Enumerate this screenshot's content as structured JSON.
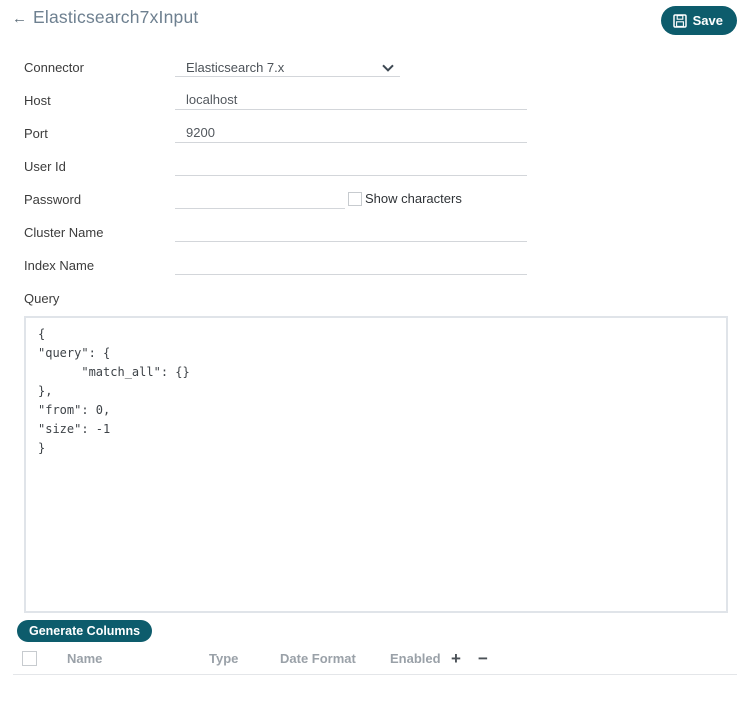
{
  "header": {
    "back_icon": "←",
    "title": "Elasticsearch7xInput",
    "save_button": {
      "label": "Save"
    }
  },
  "form": {
    "connector": {
      "label": "Connector",
      "value": "Elasticsearch 7.x"
    },
    "host": {
      "label": "Host",
      "value": "localhost"
    },
    "port": {
      "label": "Port",
      "value": "9200"
    },
    "user_id": {
      "label": "User Id",
      "value": ""
    },
    "password": {
      "label": "Password",
      "value": "",
      "show_characters": {
        "label": "Show characters",
        "checked": false
      }
    },
    "cluster_name": {
      "label": "Cluster Name",
      "value": ""
    },
    "index_name": {
      "label": "Index Name",
      "value": ""
    },
    "query": {
      "label": "Query",
      "value": "{\n\"query\": {\n      \"match_all\": {}\n},\n\"from\": 0,\n\"size\": -1\n}"
    }
  },
  "columns_section": {
    "generate_button": {
      "label": "Generate Columns"
    },
    "table_headers": {
      "name": "Name",
      "type": "Type",
      "date_format": "Date Format",
      "enabled": "Enabled"
    },
    "add_icon": "+",
    "remove_icon": "−"
  },
  "colors": {
    "accent_teal": "#0d5c6c",
    "title_gray": "#6e8090",
    "table_header_gray": "#9aa1a8"
  }
}
